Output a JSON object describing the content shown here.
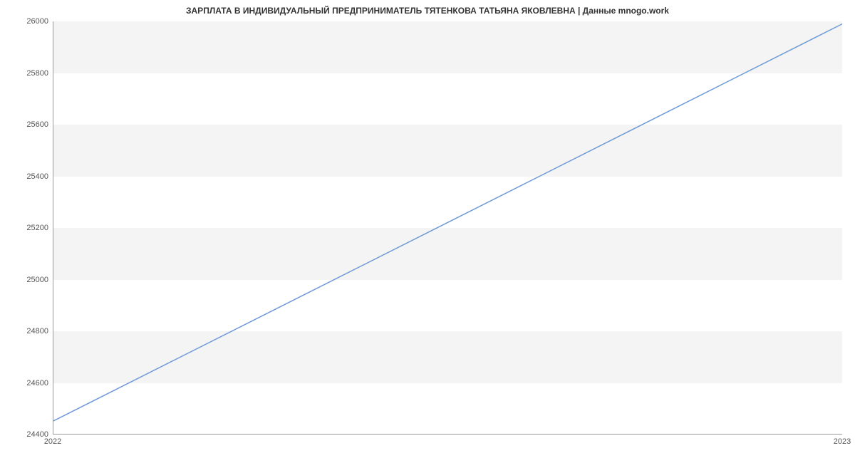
{
  "chart_data": {
    "type": "line",
    "title": "ЗАРПЛАТА В ИНДИВИДУАЛЬНЫЙ ПРЕДПРИНИМАТЕЛЬ ТЯТЕНКОВА ТАТЬЯНА ЯКОВЛЕВНА | Данные mnogo.work",
    "x": [
      2022,
      2023
    ],
    "values": [
      24450,
      25990
    ],
    "xlabel": "",
    "ylabel": "",
    "y_ticks": [
      24400,
      24600,
      24800,
      25000,
      25200,
      25400,
      25600,
      25800,
      26000
    ],
    "x_ticks": [
      2022,
      2023
    ],
    "ylim": [
      24400,
      26000
    ],
    "xlim": [
      2022,
      2023
    ],
    "line_color": "#6f9bd8"
  }
}
